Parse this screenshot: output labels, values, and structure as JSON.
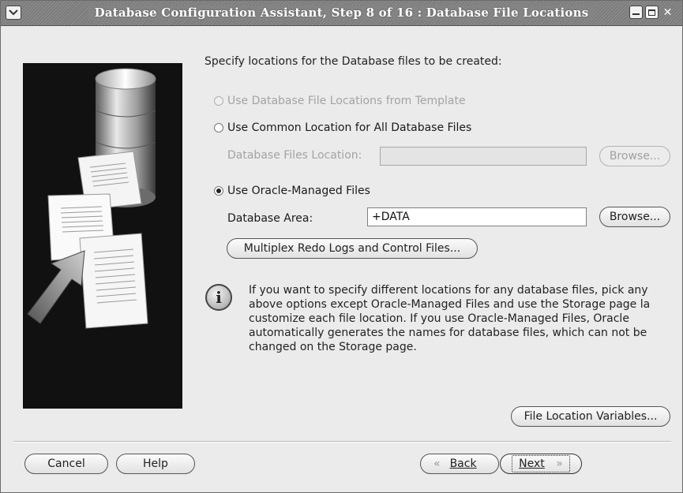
{
  "window": {
    "title": "Database Configuration Assistant, Step 8 of 16 : Database File Locations"
  },
  "icons": {
    "window_menu": "chevron-down-icon",
    "minimize": "minimize-icon",
    "maximize": "maximize-icon",
    "close": "close-icon",
    "info": "info-icon"
  },
  "main": {
    "heading": "Specify locations for the Database files to be created:",
    "options": [
      {
        "label": "Use Database File Locations from Template",
        "selected": false,
        "enabled": false
      },
      {
        "label": "Use Common Location for All Database Files",
        "selected": false,
        "enabled": true
      },
      {
        "label": "Use Oracle-Managed Files",
        "selected": true,
        "enabled": true
      }
    ],
    "common_location": {
      "label": "Database Files Location:",
      "value": "",
      "browse_label": "Browse..."
    },
    "managed": {
      "label": "Database Area:",
      "value": "+DATA",
      "browse_label": "Browse..."
    },
    "multiplex_label": "Multiplex Redo Logs and Control Files...",
    "info_text": "If you want to specify different locations for any database files, pick any\nabove options except Oracle-Managed Files and use the Storage page la\ncustomize each file location. If you use Oracle-Managed Files, Oracle\nautomatically generates the names for database files, which can not be\nchanged on the Storage page.",
    "file_location_variables_label": "File Location Variables..."
  },
  "footer": {
    "cancel_label": "Cancel",
    "help_label": "Help",
    "back_label": "Back",
    "next_label": "Next"
  },
  "colors": {
    "background": "#ebebeb",
    "titlebar": "#848484",
    "side_panel": "#111111",
    "disabled_text": "#a3a3a3"
  }
}
